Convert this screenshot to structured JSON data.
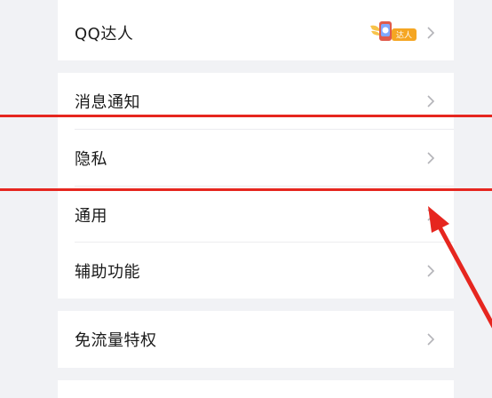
{
  "menu": {
    "qq_talent": "QQ达人",
    "talent_badge_text": "达人",
    "notifications": "消息通知",
    "privacy": "隐私",
    "general": "通用",
    "accessibility": "辅助功能",
    "free_data": "免流量特权"
  },
  "colors": {
    "background": "#f1f2f5",
    "card": "#ffffff",
    "annotation": "#e6261f",
    "badge": "#f5a623"
  },
  "icons": [
    "chevron-right-icon",
    "qq-talent-badge-icon",
    "annotation-arrow"
  ]
}
